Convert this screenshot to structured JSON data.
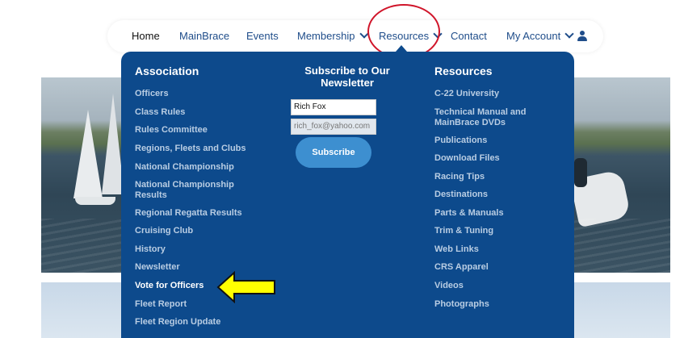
{
  "nav": {
    "home": "Home",
    "mainbrace": "MainBrace",
    "events": "Events",
    "membership": "Membership",
    "resources": "Resources",
    "contact": "Contact",
    "my_account": "My Account",
    "user_icon": "user-icon"
  },
  "menu": {
    "association": {
      "title": "Association",
      "items": [
        "Officers",
        "Class Rules",
        "Rules Committee",
        "Regions, Fleets and Clubs",
        "National Championship",
        "National Championship Results",
        "Regional Regatta Results",
        "Cruising Club",
        "History",
        "Newsletter",
        "Vote for Officers",
        "Fleet Report",
        "Fleet Region Update"
      ]
    },
    "subscribe": {
      "title": "Subscribe to Our Newsletter",
      "name_value": "Rich Fox",
      "email_value": "rich_fox@yahoo.com",
      "button": "Subscribe"
    },
    "resources": {
      "title": "Resources",
      "items": [
        "C-22 University",
        "Technical Manual and MainBrace DVDs",
        "Publications",
        "Download Files",
        "Racing Tips",
        "Destinations",
        "Parts & Manuals",
        "Trim & Tuning",
        "Web Links",
        "CRS Apparel",
        "Videos",
        "Photographs"
      ]
    }
  },
  "colors": {
    "menu_bg": "#0d4a8c",
    "nav_text": "#1f4d8a",
    "highlight": "#d0152a",
    "arrow": "#ffff00"
  }
}
